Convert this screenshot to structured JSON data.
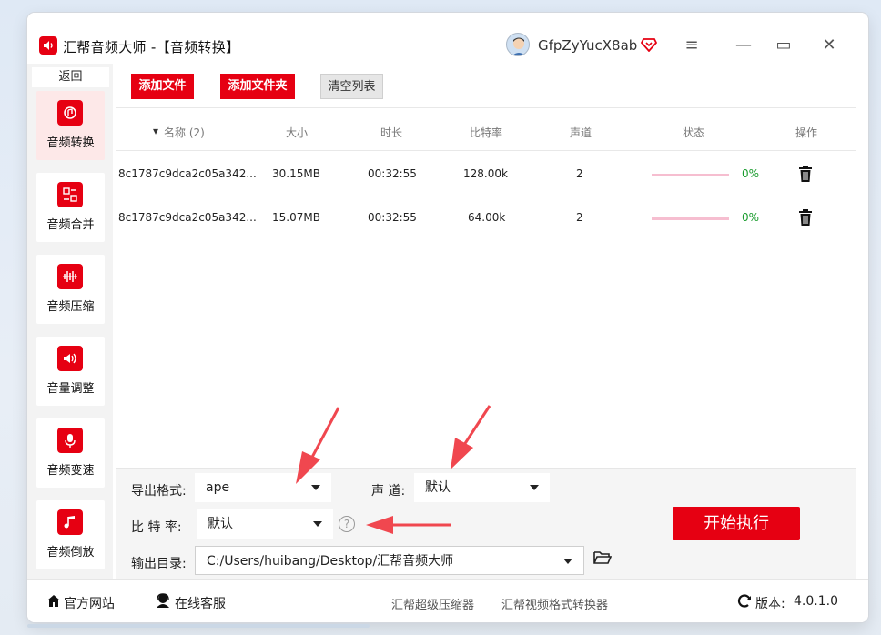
{
  "app": {
    "title": "汇帮音频大师  -【音频转换】",
    "username": "GfpZyYucX8ab",
    "accent_color": "#e60012"
  },
  "window_controls": {
    "menu": "≡",
    "minimize": "—",
    "maximize": "▭",
    "close": "✕"
  },
  "sidebar": {
    "back_label": "返回",
    "items": [
      {
        "label": "音频转换",
        "icon": "audio-convert-icon",
        "active": true
      },
      {
        "label": "音频合并",
        "icon": "audio-merge-icon",
        "active": false
      },
      {
        "label": "音频压缩",
        "icon": "audio-compress-icon",
        "active": false
      },
      {
        "label": "音量调整",
        "icon": "volume-icon",
        "active": false
      },
      {
        "label": "音频变速",
        "icon": "microphone-icon",
        "active": false
      },
      {
        "label": "音频倒放",
        "icon": "music-note-icon",
        "active": false
      }
    ]
  },
  "toolbar": {
    "add_file": "添加文件",
    "add_folder": "添加文件夹",
    "clear_list": "清空列表"
  },
  "table": {
    "columns": [
      "名称 (2)",
      "大小",
      "时长",
      "比特率",
      "声道",
      "状态",
      "操作"
    ],
    "rows": [
      {
        "name": "8c1787c9dca2c05a342...",
        "size": "30.15MB",
        "duration": "00:32:55",
        "bitrate": "128.00k",
        "channels": "2",
        "progress": "0%"
      },
      {
        "name": "8c1787c9dca2c05a342...",
        "size": "15.07MB",
        "duration": "00:32:55",
        "bitrate": "64.00k",
        "channels": "2",
        "progress": "0%"
      }
    ]
  },
  "settings": {
    "format_label": "导出格式:",
    "format_value": "ape",
    "channel_label": "声 道:",
    "channel_value": "默认",
    "bitrate_label": "比 特 率:",
    "bitrate_value": "默认",
    "help": "?",
    "output_label": "输出目录:",
    "output_value": "C:/Users/huibang/Desktop/汇帮音频大师",
    "start_button": "开始执行"
  },
  "footer": {
    "website": "官方网站",
    "support": "在线客服",
    "link1": "汇帮超级压缩器",
    "link2": "汇帮视频格式转换器",
    "version_label": "版本:",
    "version_value": "4.0.1.0"
  }
}
